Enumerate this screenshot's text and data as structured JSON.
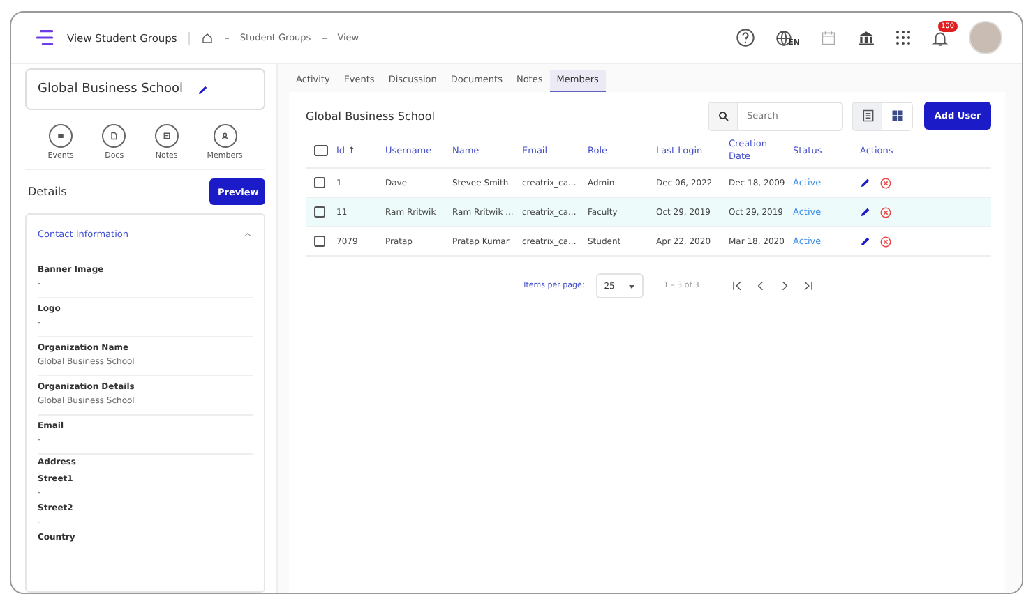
{
  "header": {
    "title": "View Student Groups",
    "breadcrumb": [
      "Student Groups",
      "View"
    ],
    "language": "EN",
    "notification_count": "100"
  },
  "sidebar": {
    "group_name": "Global Business School",
    "quick_links": [
      "Events",
      "Docs",
      "Notes",
      "Members"
    ],
    "details_title": "Details",
    "preview_button": "Preview",
    "section": {
      "title": "Contact Information",
      "expanded": true,
      "fields": [
        {
          "label": "Banner Image",
          "value": "-"
        },
        {
          "label": "Logo",
          "value": "-"
        },
        {
          "label": "Organization Name",
          "value": "Global Business School"
        },
        {
          "label": "Organization Details",
          "value": "Global Business School"
        },
        {
          "label": "Email",
          "value": "-"
        },
        {
          "label": "Address",
          "kind": "group",
          "children": [
            {
              "label": "Street1",
              "value": "-"
            },
            {
              "label": "Street2",
              "value": "-"
            },
            {
              "label": "Country"
            }
          ]
        }
      ]
    }
  },
  "tabs": [
    {
      "label": "Activity",
      "selected": false
    },
    {
      "label": "Events",
      "selected": false
    },
    {
      "label": "Discussion",
      "selected": false
    },
    {
      "label": "Documents",
      "selected": false
    },
    {
      "label": "Notes",
      "selected": false
    },
    {
      "label": "Members",
      "selected": true
    }
  ],
  "panel": {
    "title": "Global Business School",
    "search": {
      "placeholder": "Search"
    },
    "view_modes": [
      {
        "kind": "list",
        "selected": true
      },
      {
        "kind": "grid",
        "selected": false
      }
    ],
    "add_button": "Add User"
  },
  "table": {
    "select_all": {
      "checked": false
    },
    "columns": [
      {
        "label": "Id",
        "sort_indicator": "↑"
      },
      {
        "label": "Username"
      },
      {
        "label": "Name"
      },
      {
        "label": "Email"
      },
      {
        "label": "Role"
      },
      {
        "label": "Last Login"
      },
      {
        "label": "Creation Date"
      },
      {
        "label": "Status"
      },
      {
        "label": "Actions"
      }
    ],
    "rows": [
      {
        "checked": false,
        "highlighted": false,
        "cells": [
          "1",
          "Dave",
          "Stevee Smith",
          "creatrix_ca...",
          "Admin",
          "Dec 06, 2022",
          "Dec 18, 2009"
        ],
        "status": "Active"
      },
      {
        "checked": false,
        "highlighted": true,
        "cells": [
          "11",
          "Ram Rritwik",
          "Ram Rritwik ...",
          "creatrix_ca...",
          "Faculty",
          "Oct 29, 2019",
          "Oct 29, 2019"
        ],
        "status": "Active"
      },
      {
        "checked": false,
        "highlighted": false,
        "cells": [
          "7079",
          "Pratap",
          "Pratap Kumar",
          "creatrix_ca...",
          "Student",
          "Apr 22, 2020",
          "Mar 18, 2020"
        ],
        "status": "Active"
      }
    ]
  },
  "pagination": {
    "label": "Items per page:",
    "page_size": "25",
    "range": "1 – 3 of 3"
  }
}
